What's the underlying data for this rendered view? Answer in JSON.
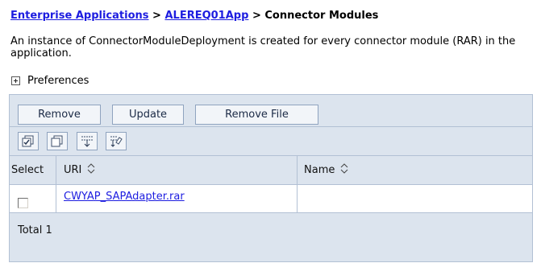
{
  "breadcrumb": {
    "link1": "Enterprise Applications",
    "sep1": ">",
    "link2": "ALEREQ01App",
    "sep2": ">",
    "current": "Connector Modules"
  },
  "description": "An instance of ConnectorModuleDeployment is created for every connector module (RAR) in the application.",
  "preferences_label": "Preferences",
  "buttons": {
    "remove": "Remove",
    "update": "Update",
    "remove_file": "Remove File"
  },
  "table": {
    "headers": {
      "select": "Select",
      "uri": "URI",
      "name": "Name"
    },
    "rows": [
      {
        "uri": "CWYAP_SAPAdapter.rar",
        "name": ""
      }
    ],
    "total": "Total 1"
  },
  "colors": {
    "link": "#1d1de0",
    "panel": "#dce4ee",
    "border": "#b2c0d4"
  }
}
